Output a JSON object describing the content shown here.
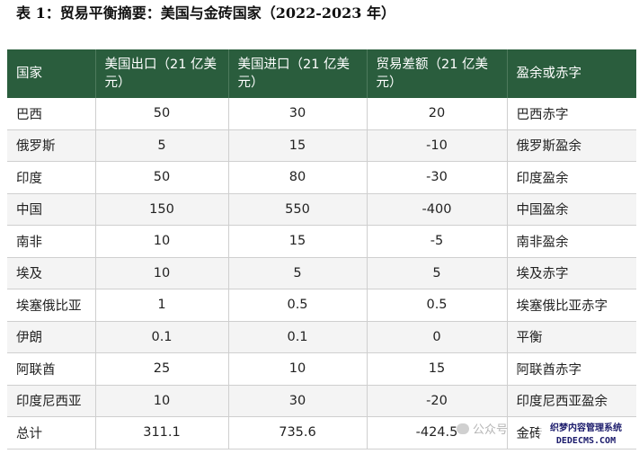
{
  "title": "表 1：贸易平衡摘要：美国与金砖国家（2022-2023 年）",
  "table": {
    "headers": [
      "国家",
      "美国出口（21 亿美元）",
      "美国进口（21 亿美元）",
      "贸易差额（21 亿美元）",
      "盈余或赤字"
    ],
    "rows": [
      [
        "巴西",
        "50",
        "30",
        "20",
        "巴西赤字"
      ],
      [
        "俄罗斯",
        "5",
        "15",
        "-10",
        "俄罗斯盈余"
      ],
      [
        "印度",
        "50",
        "80",
        "-30",
        "印度盈余"
      ],
      [
        "中国",
        "150",
        "550",
        "-400",
        "中国盈余"
      ],
      [
        "南非",
        "10",
        "15",
        "-5",
        "南非盈余"
      ],
      [
        "埃及",
        "10",
        "5",
        "5",
        "埃及赤字"
      ],
      [
        "埃塞俄比亚",
        "1",
        "0.5",
        "0.5",
        "埃塞俄比亚赤字"
      ],
      [
        "伊朗",
        "0.1",
        "0.1",
        "0",
        "平衡"
      ],
      [
        "阿联酋",
        "25",
        "10",
        "15",
        "阿联酋赤字"
      ],
      [
        "印度尼西亚",
        "10",
        "30",
        "-20",
        "印度尼西亚盈余"
      ],
      [
        "总计",
        "311.1",
        "735.6",
        "-424.5",
        "金砖"
      ]
    ]
  },
  "watermark": {
    "text": "公众号",
    "stamp_line1": "织梦内容管理系统",
    "stamp_line2": "DEDECMS.COM"
  },
  "colors": {
    "header_bg": "#2a5d3d",
    "header_text": "#ffffff",
    "row_alt_bg": "#f4f4f4"
  }
}
